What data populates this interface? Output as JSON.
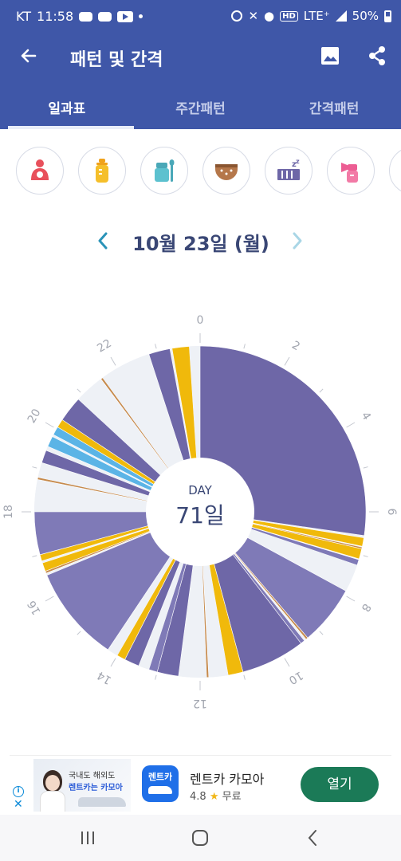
{
  "status_bar": {
    "carrier": "KT",
    "time": "11:58",
    "network": "LTE⁺",
    "hd": "HD",
    "battery": "50%"
  },
  "header": {
    "title": "패턴 및 간격",
    "icons": [
      "back-arrow-icon",
      "image-icon",
      "share-icon"
    ]
  },
  "tabs": [
    {
      "label": "일과표",
      "active": true
    },
    {
      "label": "주간패턴",
      "active": false
    },
    {
      "label": "간격패턴",
      "active": false
    }
  ],
  "activity_icons": [
    "breastfeeding-icon",
    "bottle-icon",
    "baby-food-icon",
    "diaper-icon",
    "sleep-icon",
    "breast-pump-icon"
  ],
  "date_nav": {
    "date": "10월 23일 (월)"
  },
  "chart_center": {
    "label": "DAY",
    "value": "71일"
  },
  "colors": {
    "primary": "#3f57a8",
    "sleep": "#6e67a7",
    "sleep_light": "#7f7ab7",
    "feeding": "#f0b90b",
    "pumping": "#5bb4e6",
    "empty": "#eef1f6",
    "line": "#c68a4c"
  },
  "chart_data": {
    "type": "pie",
    "hour_ticks": [
      "0",
      "2",
      "4",
      "6",
      "8",
      "10",
      "12",
      "14",
      "16",
      "18",
      "20",
      "22"
    ],
    "segments": [
      {
        "start": 0.0,
        "end": 6.55,
        "kind": "sleep"
      },
      {
        "start": 6.6,
        "end": 6.8,
        "kind": "feeding"
      },
      {
        "start": 6.82,
        "end": 6.86,
        "kind": "line"
      },
      {
        "start": 6.86,
        "end": 7.1,
        "kind": "feeding"
      },
      {
        "start": 7.12,
        "end": 7.25,
        "kind": "sleep_light"
      },
      {
        "start": 7.25,
        "end": 7.9,
        "kind": "empty"
      },
      {
        "start": 7.9,
        "end": 9.3,
        "kind": "sleep_light"
      },
      {
        "start": 9.3,
        "end": 9.35,
        "kind": "line"
      },
      {
        "start": 9.4,
        "end": 9.5,
        "kind": "sleep_light"
      },
      {
        "start": 9.5,
        "end": 11.0,
        "kind": "sleep"
      },
      {
        "start": 11.0,
        "end": 11.35,
        "kind": "feeding"
      },
      {
        "start": 11.35,
        "end": 11.75,
        "kind": "empty"
      },
      {
        "start": 11.8,
        "end": 11.85,
        "kind": "line"
      },
      {
        "start": 11.85,
        "end": 12.5,
        "kind": "empty"
      },
      {
        "start": 12.5,
        "end": 13.0,
        "kind": "sleep"
      },
      {
        "start": 13.0,
        "end": 13.2,
        "kind": "sleep_light"
      },
      {
        "start": 13.2,
        "end": 13.45,
        "kind": "empty"
      },
      {
        "start": 13.45,
        "end": 13.8,
        "kind": "sleep"
      },
      {
        "start": 13.8,
        "end": 14.0,
        "kind": "feeding"
      },
      {
        "start": 14.0,
        "end": 14.25,
        "kind": "empty"
      },
      {
        "start": 14.25,
        "end": 16.5,
        "kind": "sleep_light"
      },
      {
        "start": 16.55,
        "end": 16.6,
        "kind": "line"
      },
      {
        "start": 16.6,
        "end": 16.8,
        "kind": "feeding"
      },
      {
        "start": 16.85,
        "end": 17.0,
        "kind": "feeding"
      },
      {
        "start": 17.0,
        "end": 18.0,
        "kind": "sleep_light"
      },
      {
        "start": 18.0,
        "end": 18.75,
        "kind": "empty"
      },
      {
        "start": 18.75,
        "end": 18.8,
        "kind": "line"
      },
      {
        "start": 18.8,
        "end": 19.15,
        "kind": "empty"
      },
      {
        "start": 19.15,
        "end": 19.45,
        "kind": "sleep"
      },
      {
        "start": 19.55,
        "end": 19.8,
        "kind": "pumping"
      },
      {
        "start": 19.85,
        "end": 20.05,
        "kind": "pumping"
      },
      {
        "start": 20.05,
        "end": 20.25,
        "kind": "feeding"
      },
      {
        "start": 20.25,
        "end": 20.85,
        "kind": "sleep"
      },
      {
        "start": 20.85,
        "end": 21.55,
        "kind": "empty"
      },
      {
        "start": 21.55,
        "end": 21.6,
        "kind": "line"
      },
      {
        "start": 21.6,
        "end": 22.8,
        "kind": "empty"
      },
      {
        "start": 22.8,
        "end": 23.3,
        "kind": "sleep"
      },
      {
        "start": 23.35,
        "end": 23.75,
        "kind": "feeding"
      },
      {
        "start": 23.75,
        "end": 24.0,
        "kind": "empty"
      }
    ]
  },
  "ad": {
    "image_line1": "국내도 해외도",
    "image_line2": "렌트카는 카모아",
    "logo_text": "렌트카",
    "name": "렌트카 카모아",
    "rating": "4.8",
    "price": "무료",
    "button": "열기",
    "info_icon": "info-icon",
    "close_icon": "close-icon"
  },
  "navbar": {
    "icons": [
      "recent-apps-icon",
      "home-icon",
      "back-icon"
    ]
  }
}
